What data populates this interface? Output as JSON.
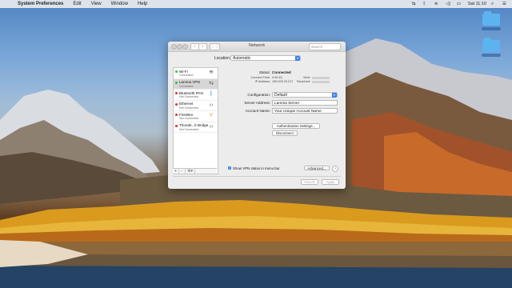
{
  "menubar": {
    "apple_icon": "apple-icon",
    "app_name": "System Preferences",
    "items": [
      "Edit",
      "View",
      "Window",
      "Help"
    ],
    "clock": "Sat 11:10"
  },
  "window": {
    "title": "Network",
    "search_placeholder": "Search",
    "location_label": "Location:",
    "location_value": "Automatic",
    "services": [
      {
        "name": "Wi-Fi",
        "status": "Connected",
        "dot": "#2fbf3a",
        "icon": "wifi-icon",
        "glyph": "≋"
      },
      {
        "name": "Lamnia VPN",
        "status": "Connected",
        "dot": "#2fbf3a",
        "icon": "vpn-icon",
        "glyph": "⇆"
      },
      {
        "name": "Bluetooth PAN",
        "status": "Not Connected",
        "dot": "#d8322c",
        "icon": "bluetooth-icon",
        "glyph": "ᛒ"
      },
      {
        "name": "Ethernet",
        "status": "Not Connected",
        "dot": "#d8322c",
        "icon": "ethernet-icon",
        "glyph": "‹›"
      },
      {
        "name": "FireWire",
        "status": "Not Connected",
        "dot": "#d8322c",
        "icon": "firewire-icon",
        "glyph": "Y"
      },
      {
        "name": "Thunde...lt Bridge",
        "status": "Not Connected",
        "dot": "#d8322c",
        "icon": "thunderbolt-bridge-icon",
        "glyph": "‹›"
      }
    ],
    "sidebar_tools": [
      "+",
      "−",
      "⚙▾"
    ],
    "status_label": "Status:",
    "status_value": "Connected",
    "connect_time_label": "Connect Time:",
    "connect_time_value": "0:00:15",
    "ip_label": "IP Address:",
    "ip_value": "195.200.23.217",
    "sent_label": "Sent:",
    "received_label": "Received:",
    "sent_fraction": 0.0,
    "received_fraction": 0.0,
    "configuration_label": "Configuration:",
    "configuration_value": "Default",
    "server_label": "Server Address:",
    "server_value": "Lamnia Server",
    "account_label": "Account Name:",
    "account_value": "Your Unique Account Name",
    "auth_button": "Authentication Settings...",
    "disconnect_button": "Disconnect",
    "show_vpn_label": "Show VPN status in menu bar",
    "show_vpn_checked": true,
    "advanced_button": "Advanced...",
    "help_button": "?",
    "revert_button": "Revert",
    "apply_button": "Apply"
  },
  "desktop": {
    "folders": [
      "",
      ""
    ]
  }
}
